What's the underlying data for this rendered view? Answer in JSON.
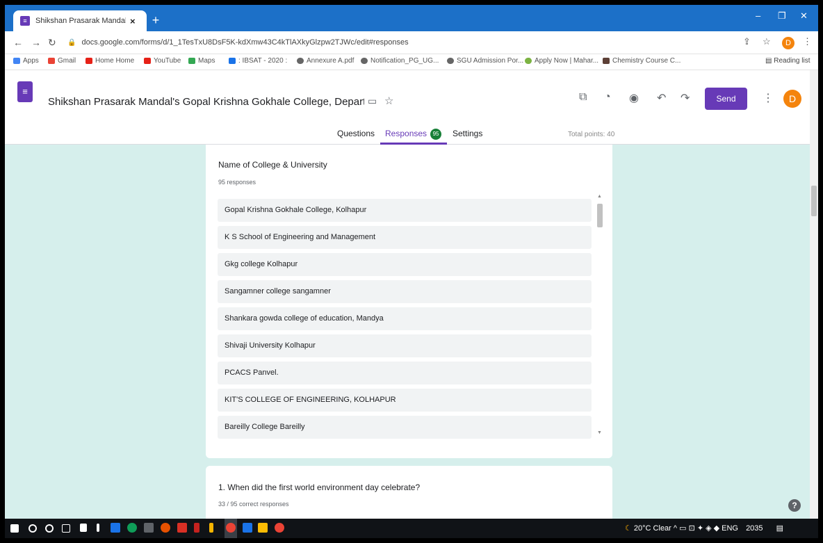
{
  "browser": {
    "tab_title": "Shikshan Prasarak Mandal's Gop",
    "tab_close": "×",
    "new_tab": "+",
    "url": "docs.google.com/forms/d/1_1TesTxU8DsF5K-kdXmw43C4kTlAXkyGlzpw2TJWc/edit#responses",
    "bookmarks": [
      {
        "label": "Apps",
        "color": "#4285f4"
      },
      {
        "label": "Gmail",
        "color": "#ea4335"
      },
      {
        "label": "Home Home",
        "color": "#e62117"
      },
      {
        "label": "YouTube",
        "color": "#e62117"
      },
      {
        "label": "Maps",
        "color": "#34a853"
      },
      {
        "label": ": IBSAT - 2020 :",
        "color": "#1a73e8"
      },
      {
        "label": "Annexure A.pdf",
        "color": "#666666"
      },
      {
        "label": "Notification_PG_UG...",
        "color": "#666666"
      },
      {
        "label": "SGU Admission Por...",
        "color": "#666666"
      },
      {
        "label": "Apply Now | Mahar...",
        "color": "#7cb342"
      },
      {
        "label": "Chemistry Course C...",
        "color": "#5d4037"
      }
    ],
    "reading_list": "Reading list",
    "profile_initial": "D"
  },
  "form": {
    "title": "Shikshan Prasarak Mandal's Gopal Krishna Gokhale College, Department",
    "send_label": "Send",
    "profile_initial": "D",
    "tabs": {
      "questions": "Questions",
      "responses": "Responses",
      "responses_count": "95",
      "settings": "Settings"
    },
    "total_points": "Total points: 40"
  },
  "question1": {
    "title": "Name of College & University",
    "responses": "95 responses",
    "answers": [
      "Gopal Krishna Gokhale College, Kolhapur",
      "K S School of Engineering and Management",
      "Gkg college Kolhapur",
      "Sangamner college sangamner",
      "Shankara gowda college of education, Mandya",
      "Shivaji University Kolhapur",
      "PCACS Panvel.",
      "KIT'S COLLEGE OF ENGINEERING, KOLHAPUR",
      "Bareilly College Bareilly"
    ]
  },
  "question2": {
    "title": "1. When did the first world environment day celebrate?",
    "responses": "33 / 95 correct responses"
  },
  "taskbar": {
    "weather": "20°C Clear",
    "language": "ENG",
    "time": "2035"
  },
  "colors": {
    "brand": "#673ab7",
    "content_bg": "#d6efec",
    "tab_strip": "#1c70c8",
    "badge": "#188038"
  }
}
